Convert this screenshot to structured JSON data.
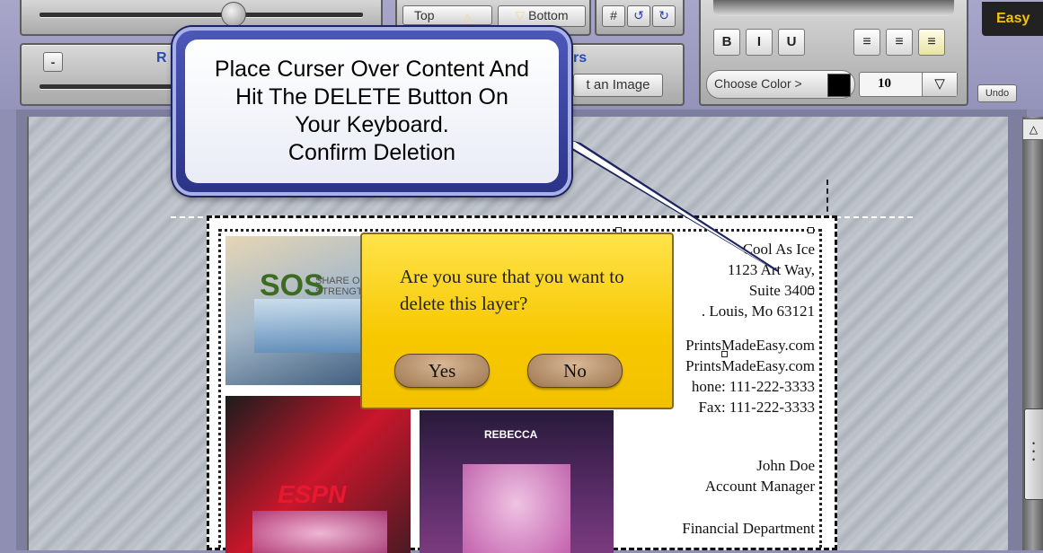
{
  "toolbar": {
    "minus_label": "-",
    "partial_left_label": "R",
    "partial_layers_label": "rs",
    "top_label": "Top",
    "bottom_label": "Bottom",
    "insert_image_label": "t an Image",
    "bold_label": "B",
    "italic_label": "I",
    "underline_label": "U",
    "choose_color_label": "Choose Color >",
    "color_value": "#000000",
    "font_size_value": "10",
    "easy_label": "Easy",
    "undo_label": "Undo"
  },
  "callout": {
    "text": "Place Curser Over Content And\nHit The DELETE Button On\nYour Keyboard.\nConfirm Deletion"
  },
  "card": {
    "company": "Cool As Ice",
    "address1": "1123 Art Way,",
    "address2": "Suite 3400",
    "city": ". Louis, Mo 63121",
    "email1": "PrintsMadeEasy.com",
    "email2": "PrintsMadeEasy.com",
    "phone": "hone: 111-222-3333",
    "fax": "Fax: 111-222-3333",
    "name": "John Doe",
    "title": "Account Manager",
    "department": "Financial Department",
    "photo1_text": "SOS",
    "photo1_sub": "SHARE OU\nSTRENGT",
    "photo2_text": "ESPN",
    "photo3_text": "REBECCA"
  },
  "dialog": {
    "message": "Are you sure that you want to delete this layer?",
    "yes_label": "Yes",
    "no_label": "No"
  },
  "colors": {
    "toolbar_bg": "#9493ba",
    "callout_border": "#2b3487",
    "dialog_bg": "#f7c800",
    "easy_badge": "#f5c400"
  }
}
